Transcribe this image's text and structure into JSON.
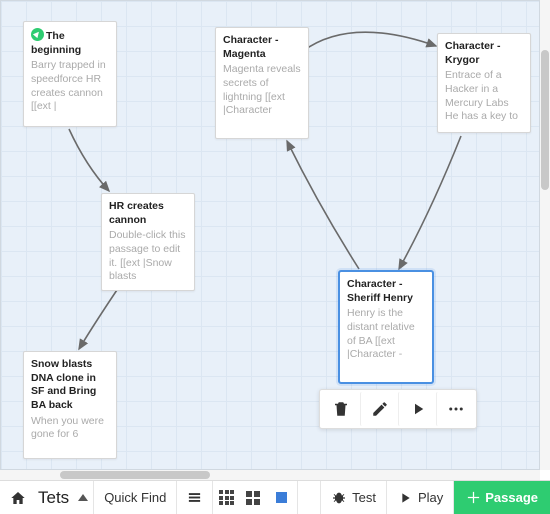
{
  "story": {
    "name": "Tets"
  },
  "nodes": {
    "beginning": {
      "title": "The beginning",
      "body": "Barry trapped in speedforce HR creates cannon [[ext |"
    },
    "hrcannon": {
      "title": "HR creates cannon",
      "body": "Double-click this passage to edit it. [[ext |Snow blasts"
    },
    "magenta": {
      "title": "Character - Magenta",
      "body": "Magenta reveals secrets of lightning [[ext |Character"
    },
    "krygor": {
      "title": "Character - Krygor",
      "body": "Entrace of a Hacker in a Mercury Labs He has a key to"
    },
    "sheriff": {
      "title": "Character - Sheriff Henry",
      "body": "Henry is the distant relative of BA [[ext |Character -"
    },
    "snow": {
      "title": "Snow blasts DNA clone in SF and Bring BA back",
      "body": "When you were gone for 6"
    }
  },
  "toolbar": {
    "quickfind": "Quick Find",
    "test": "Test",
    "play": "Play",
    "passage": "Passage"
  }
}
